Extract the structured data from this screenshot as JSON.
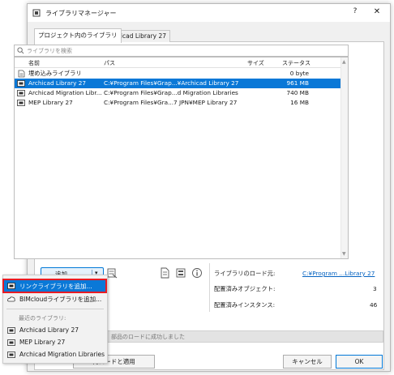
{
  "window": {
    "title": "ライブラリマネージャー",
    "help_label": "?",
    "close_label": "✕"
  },
  "tabs": [
    {
      "label": "プロジェクト内のライブラリ",
      "active": true
    },
    {
      "label": "Archicad Library 27",
      "active": false
    }
  ],
  "search": {
    "placeholder": "ライブラリを検索"
  },
  "columns": {
    "name": "名前",
    "path": "パス",
    "size": "サイズ",
    "status": "ステータス"
  },
  "rows": [
    {
      "name": "埋め込みライブラリ",
      "path": "",
      "size": "0 byte",
      "selected": false
    },
    {
      "name": "Archicad Library 27",
      "path": "C:¥Program Files¥Grap...¥Archicad Library 27",
      "size": "961 MB",
      "selected": true
    },
    {
      "name": "Archicad Migration Libr...",
      "path": "C:¥Program Files¥Grap...d Migration Libraries",
      "size": "740 MB",
      "selected": false
    },
    {
      "name": "MEP Library 27",
      "path": "C:¥Program Files¥Gra...7 JPN¥MEP Library 27",
      "size": "16 MB",
      "selected": false
    }
  ],
  "toolbar": {
    "add_label": "追加...",
    "dropdown_arrow": "▾"
  },
  "info": {
    "loaded_from_label": "ライブラリのロード元:",
    "loaded_from_value": "C:¥Program ...Library 27",
    "placed_objects_label": "配置済みオブジェクト:",
    "placed_objects_value": "3",
    "placed_instances_label": "配置済みインスタンス:",
    "placed_instances_value": "46"
  },
  "status_text": "部品のロードに成功しました",
  "buttons": {
    "reload_apply": "再ロードと適用",
    "cancel": "キャンセル",
    "ok": "OK"
  },
  "menu": {
    "add_linked": "リンクライブラリを追加...",
    "add_bimcloud": "BIMcloudライブラリを追加...",
    "recent_header": "最近のライブラリ:",
    "recent": [
      "Archicad Library 27",
      "MEP Library 27",
      "Archicad Migration Libraries"
    ]
  },
  "colors": {
    "selection": "#0a78d7",
    "highlight_border": "#e81b23",
    "link": "#0563c1"
  }
}
